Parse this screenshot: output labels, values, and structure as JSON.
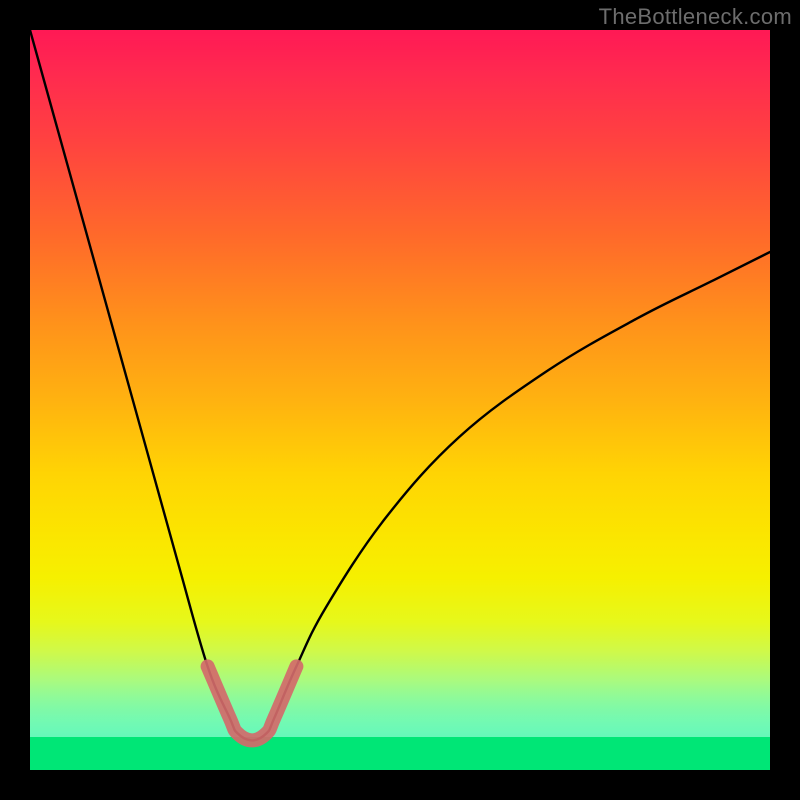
{
  "watermark": "TheBottleneck.com",
  "chart_data": {
    "type": "line",
    "title": "",
    "xlabel": "",
    "ylabel": "",
    "xlim": [
      0,
      100
    ],
    "ylim": [
      0,
      100
    ],
    "notes": "V-shaped bottleneck curve on a red-to-green vertical gradient. Minimum (optimal match) near x≈30 where y≈4. Left branch rises steeply to ~100 at x=0; right branch rises concavely to ~70 at x=100.",
    "series": [
      {
        "name": "bottleneck-curve",
        "x": [
          0,
          5,
          10,
          15,
          20,
          24,
          27,
          28,
          30,
          32,
          33,
          36,
          40,
          48,
          58,
          70,
          82,
          92,
          100
        ],
        "values": [
          100,
          82,
          64,
          46,
          28,
          14,
          7,
          5,
          4,
          5,
          7,
          14,
          22,
          34,
          45,
          54,
          61,
          66,
          70
        ]
      },
      {
        "name": "highlight-band",
        "x": [
          24,
          27,
          28,
          30,
          32,
          33,
          36
        ],
        "values": [
          14,
          7,
          5,
          4,
          5,
          7,
          14
        ]
      }
    ],
    "gradient_stops": [
      {
        "pct": 0,
        "color": "#ff1955"
      },
      {
        "pct": 50,
        "color": "#ffb210"
      },
      {
        "pct": 74,
        "color": "#f6f000"
      },
      {
        "pct": 100,
        "color": "#00efc8"
      }
    ]
  }
}
